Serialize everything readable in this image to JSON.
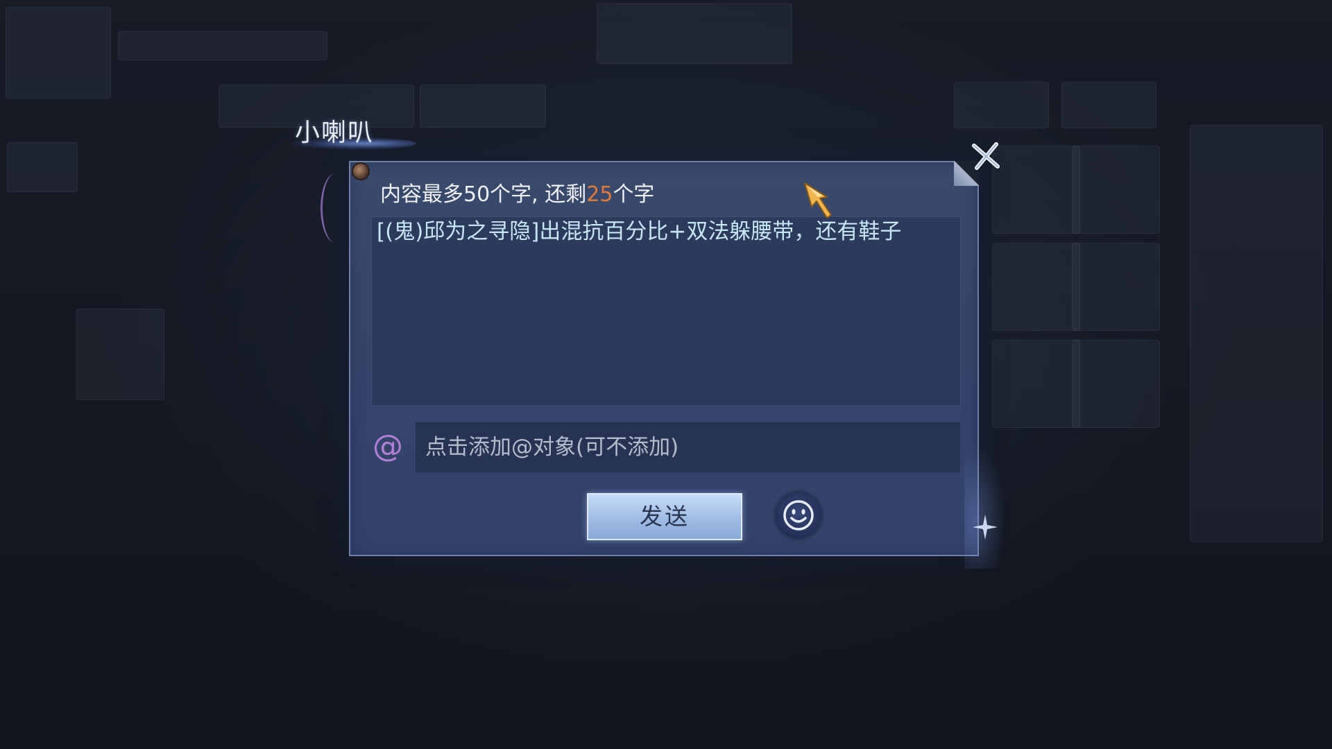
{
  "dialog": {
    "title": "小喇叭",
    "hint_prefix": "内容最多50个字, 还剩",
    "remaining_count": "25",
    "hint_suffix": "个字",
    "message_text": "[(鬼)邱为之寻隐]出混抗百分比+双法躲腰带，还有鞋子",
    "at_symbol": "@",
    "at_placeholder": "点击添加@对象(可不添加)",
    "send_label": "发送"
  },
  "icons": {
    "close": "close-icon",
    "emoji": "smiley-face-icon",
    "cursor": "golden-arrow-cursor-icon"
  },
  "colors": {
    "remaining_count": "#e07a3c",
    "message_text": "#c6e6f4",
    "at_symbol": "#b27fd6",
    "dialog_bg": "#34446a"
  }
}
